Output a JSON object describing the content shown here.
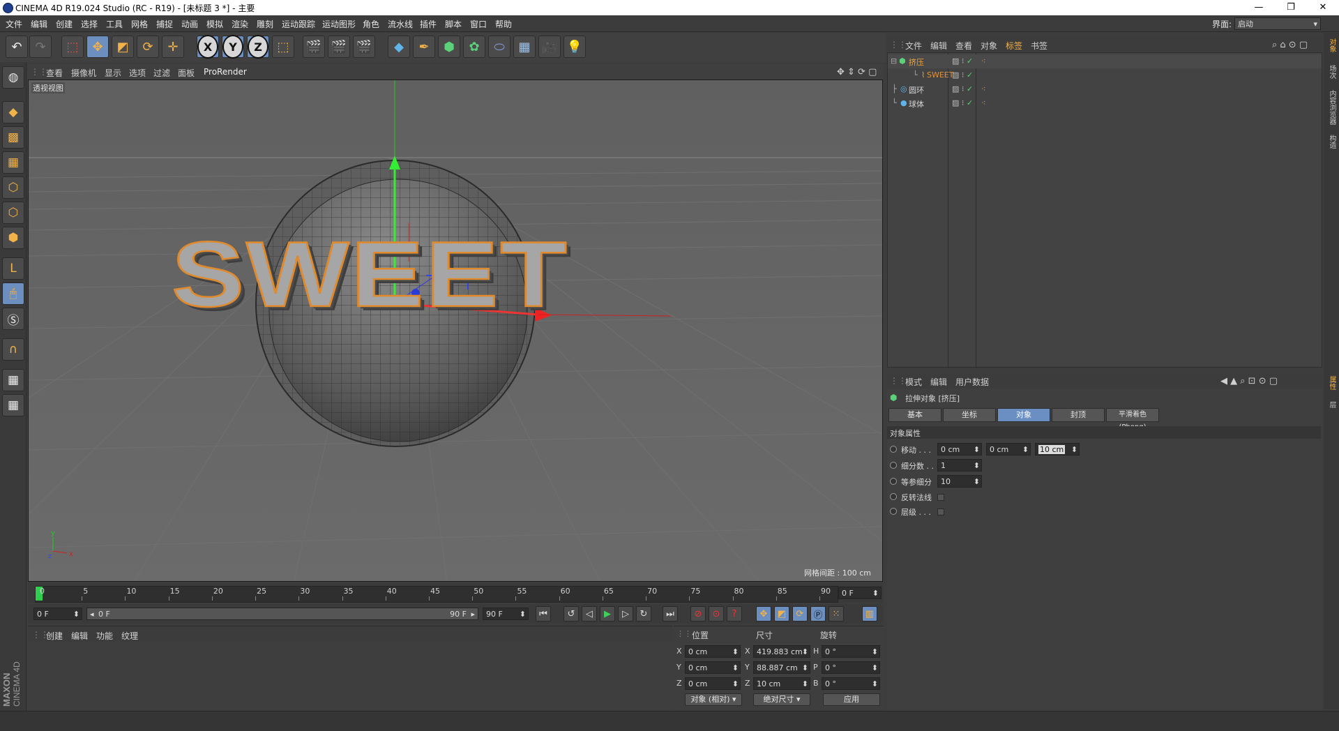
{
  "window": {
    "title": "CINEMA 4D R19.024 Studio (RC - R19) - [未标题 3 *] - 主要",
    "minimize_icon": "minimize-icon",
    "maximize_icon": "restore-icon",
    "close_icon": "close-icon"
  },
  "menubar": {
    "items": [
      "文件",
      "编辑",
      "创建",
      "选择",
      "工具",
      "网格",
      "捕捉",
      "动画",
      "模拟",
      "渲染",
      "雕刻",
      "运动跟踪",
      "运动图形",
      "角色",
      "流水线",
      "插件",
      "脚本",
      "窗口",
      "帮助"
    ],
    "layout_label": "界面:",
    "layout_value": "启动"
  },
  "viewport": {
    "menu": [
      "查看",
      "摄像机",
      "显示",
      "选项",
      "过滤",
      "面板",
      "ProRender"
    ],
    "label": "透视视图",
    "grid_info": "网格间距 : 100 cm",
    "text_object": "SWEET",
    "axis_y": "y",
    "axis_x": "x",
    "axis_z": "z"
  },
  "timeline": {
    "ticks": [
      "0",
      "5",
      "10",
      "15",
      "20",
      "25",
      "30",
      "35",
      "40",
      "45",
      "50",
      "55",
      "60",
      "65",
      "70",
      "75",
      "80",
      "85",
      "90"
    ],
    "end_field": "0 F",
    "start_frame": "0 F",
    "range_start": "0 F",
    "range_end": "90 F",
    "max_frame": "90 F"
  },
  "material_panel": {
    "menu": [
      "创建",
      "编辑",
      "功能",
      "纹理"
    ],
    "brand_top": "MAXON",
    "brand_bottom": "CINEMA 4D"
  },
  "coord_panel": {
    "headers": [
      "位置",
      "尺寸",
      "旋转"
    ],
    "rows": [
      {
        "axis": "X",
        "pos": "0 cm",
        "size_axis": "X",
        "size": "419.883 cm",
        "rot_axis": "H",
        "rot": "0 °"
      },
      {
        "axis": "Y",
        "pos": "0 cm",
        "size_axis": "Y",
        "size": "88.887 cm",
        "rot_axis": "P",
        "rot": "0 °"
      },
      {
        "axis": "Z",
        "pos": "0 cm",
        "size_axis": "Z",
        "size": "10 cm",
        "rot_axis": "B",
        "rot": "0 °"
      }
    ],
    "mode": "对象 (相对)",
    "size_mode": "绝对尺寸",
    "apply": "应用"
  },
  "object_manager": {
    "menu": [
      "文件",
      "编辑",
      "查看",
      "对象",
      "标签",
      "书签"
    ],
    "objects": [
      {
        "name": "挤压",
        "indent": 0,
        "color": "#f2a43a"
      },
      {
        "name": "SWEET",
        "indent": 1,
        "color": "#e0943a"
      },
      {
        "name": "圆环",
        "indent": 0,
        "color": "#d4d4d4"
      },
      {
        "name": "球体",
        "indent": 0,
        "color": "#d4d4d4"
      }
    ]
  },
  "attribute_manager": {
    "menu": [
      "模式",
      "编辑",
      "用户数据"
    ],
    "title": "拉伸对象 [挤压]",
    "tabs": [
      "基本",
      "坐标",
      "对象",
      "封顶",
      "平滑着色(Phong)"
    ],
    "selected_tab": "对象",
    "section": "对象属性",
    "move_label": "移动 . . .",
    "move_values": [
      "0 cm",
      "0 cm",
      "10 cm"
    ],
    "subdiv_label": "细分数 . .",
    "subdiv_value": "1",
    "isoparm_label": "等参细分",
    "isoparm_value": "10",
    "flip_label": "反转法线",
    "hier_label": "层级 . . ."
  },
  "side_tabs": [
    "对象",
    "场次",
    "内容浏览器",
    "构造",
    "属性",
    "层"
  ]
}
